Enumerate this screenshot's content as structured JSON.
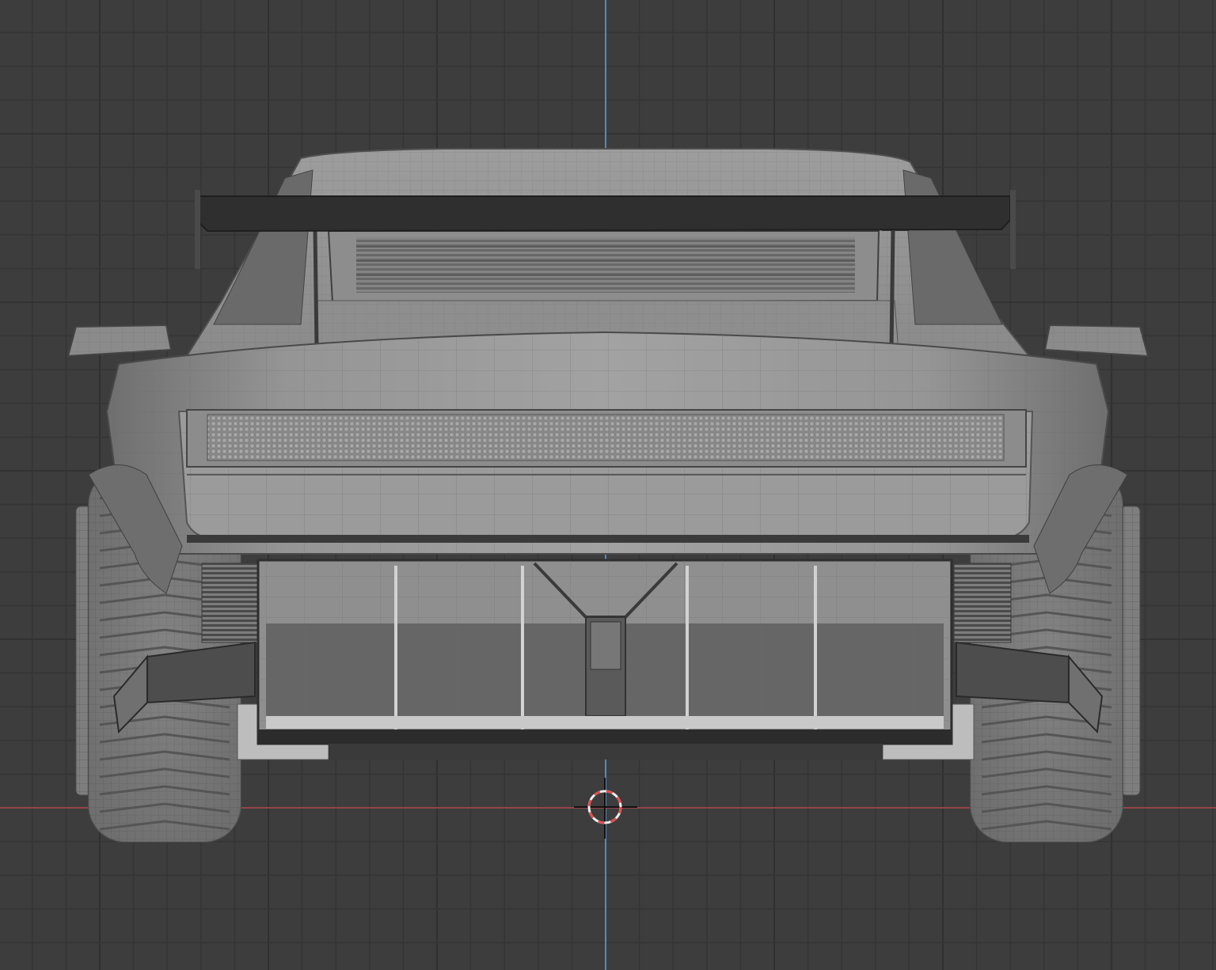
{
  "viewport": {
    "colors": {
      "background": "#3d3d3d",
      "grid_minor": "#353535",
      "grid_major": "#2e2e2e",
      "axis_x": "#b34a54",
      "axis_z": "#4f8ac6",
      "body_light": "#9a9a9a",
      "body_mid": "#858585",
      "body_dark": "#555555",
      "wire": "#6e6e6e",
      "tire": "#7b7b7b",
      "wing": "#2f2f2f",
      "cursor_red": "#e05050",
      "cursor_white": "#f0f0f0"
    },
    "icons": {
      "cursor": "3d-cursor-icon"
    }
  }
}
